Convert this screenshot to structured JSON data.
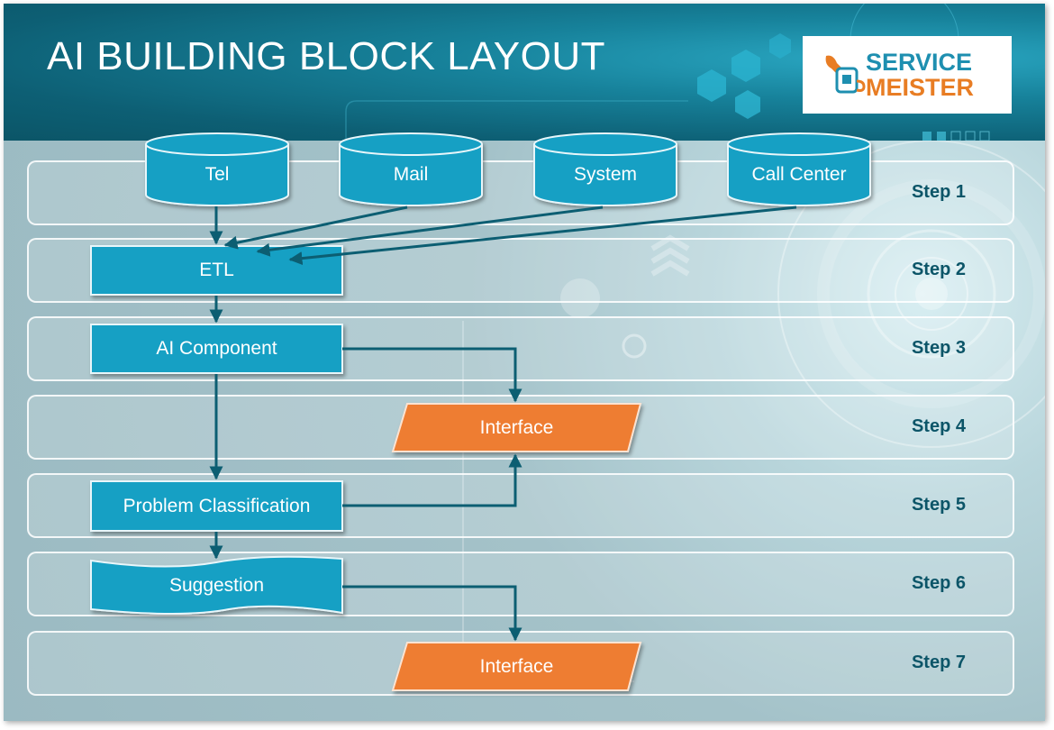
{
  "title": "AI BUILDING BLOCK LAYOUT",
  "logo": {
    "line1": "SERVICE",
    "line2": "MEISTER",
    "icon": "wrench-glove-icon",
    "colors": {
      "primary": "#1e8fb0",
      "accent": "#e87d24"
    }
  },
  "colors": {
    "block": "#16a0c4",
    "interface": "#ee7d31",
    "arrow": "#0c5e72",
    "step_text": "#0c5568"
  },
  "steps": [
    "Step 1",
    "Step 2",
    "Step 3",
    "Step 4",
    "Step 5",
    "Step 6",
    "Step 7"
  ],
  "sources": [
    "Tel",
    "Mail",
    "System",
    "Call Center"
  ],
  "blocks": {
    "etl": "ETL",
    "ai_component": "AI Component",
    "interface_1": "Interface",
    "problem_classification": "Problem Classification",
    "suggestion": "Suggestion",
    "interface_2": "Interface"
  },
  "connections": [
    {
      "from": "Tel",
      "to": "ETL"
    },
    {
      "from": "Mail",
      "to": "ETL"
    },
    {
      "from": "System",
      "to": "ETL"
    },
    {
      "from": "Call Center",
      "to": "ETL"
    },
    {
      "from": "ETL",
      "to": "AI Component"
    },
    {
      "from": "AI Component",
      "to": "Interface (Step 4)"
    },
    {
      "from": "AI Component",
      "to": "Problem Classification"
    },
    {
      "from": "Problem Classification",
      "to": "Interface (Step 4)"
    },
    {
      "from": "Problem Classification",
      "to": "Suggestion"
    },
    {
      "from": "Suggestion",
      "to": "Interface (Step 7)"
    }
  ]
}
